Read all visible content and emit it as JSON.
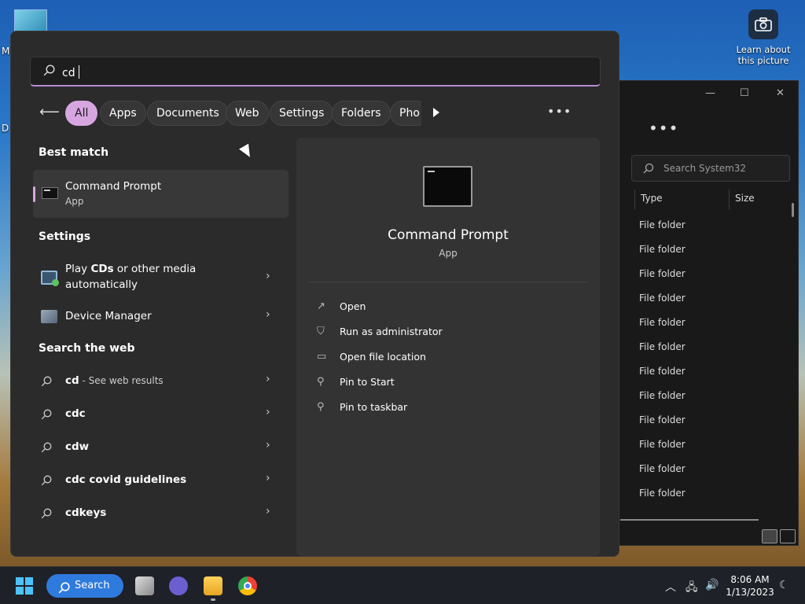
{
  "desktop": {
    "edge_labels": [
      "M",
      "D"
    ],
    "spotlight_label": "Learn about this picture"
  },
  "explorer": {
    "search_placeholder": "Search System32",
    "columns": [
      "Type",
      "Size"
    ],
    "rows": [
      "File folder",
      "File folder",
      "File folder",
      "File folder",
      "File folder",
      "File folder",
      "File folder",
      "File folder",
      "File folder",
      "File folder",
      "File folder",
      "File folder"
    ]
  },
  "search": {
    "query": "cd",
    "filters": [
      "All",
      "Apps",
      "Documents",
      "Web",
      "Settings",
      "Folders",
      "Pho"
    ],
    "active_filter": "All"
  },
  "results": {
    "best_match_heading": "Best match",
    "best_match": {
      "name": "Command Prompt",
      "kind": "App"
    },
    "settings_heading": "Settings",
    "settings": [
      {
        "pre": "Play ",
        "bold": "CDs",
        "post": " or other media",
        "line2": "automatically"
      },
      {
        "label": "Device Manager"
      }
    ],
    "web_heading": "Search the web",
    "web": [
      {
        "bold": "cd",
        "suffix": " - See web results"
      },
      {
        "bold": "cdc",
        "suffix": ""
      },
      {
        "bold": "cdw",
        "suffix": ""
      },
      {
        "bold": "cdc covid guidelines",
        "suffix": ""
      },
      {
        "bold": "cdkeys",
        "suffix": ""
      }
    ]
  },
  "detail": {
    "name": "Command Prompt",
    "kind": "App",
    "actions": [
      {
        "icon": "open-icon",
        "label": "Open"
      },
      {
        "icon": "shield-icon",
        "label": "Run as administrator"
      },
      {
        "icon": "folder-icon",
        "label": "Open file location"
      },
      {
        "icon": "pin-icon",
        "label": "Pin to Start"
      },
      {
        "icon": "pin-icon",
        "label": "Pin to taskbar"
      }
    ]
  },
  "taskbar": {
    "search_label": "Search",
    "time": "8:06 AM",
    "date": "1/13/2023"
  }
}
